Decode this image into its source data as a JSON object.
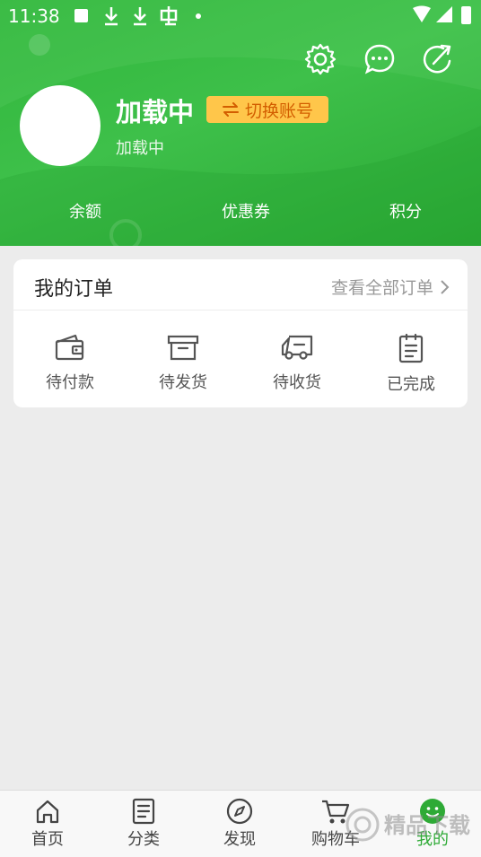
{
  "status_bar": {
    "time": "11:38"
  },
  "header": {
    "icons": [
      "settings-icon",
      "message-icon",
      "share-icon"
    ],
    "user_name": "加载中",
    "switch_account_label": "切换账号",
    "user_sub": "加载中",
    "stats": [
      {
        "label": "余额"
      },
      {
        "label": "优惠券"
      },
      {
        "label": "积分"
      }
    ]
  },
  "orders": {
    "title": "我的订单",
    "view_all": "查看全部订单",
    "items": [
      {
        "label": "待付款",
        "icon": "wallet-icon"
      },
      {
        "label": "待发货",
        "icon": "box-icon"
      },
      {
        "label": "待收货",
        "icon": "truck-icon"
      },
      {
        "label": "已完成",
        "icon": "clipboard-icon"
      }
    ]
  },
  "bottom_nav": {
    "items": [
      {
        "label": "首页",
        "icon": "home-icon"
      },
      {
        "label": "分类",
        "icon": "list-icon"
      },
      {
        "label": "发现",
        "icon": "compass-icon"
      },
      {
        "label": "购物车",
        "icon": "cart-icon"
      },
      {
        "label": "我的",
        "icon": "profile-icon",
        "active": true
      }
    ]
  },
  "watermark": "精品下载",
  "colors": {
    "brand_green": "#3ec04a",
    "accent_yellow": "#ffc64a",
    "active_tab": "#2eaa36"
  }
}
